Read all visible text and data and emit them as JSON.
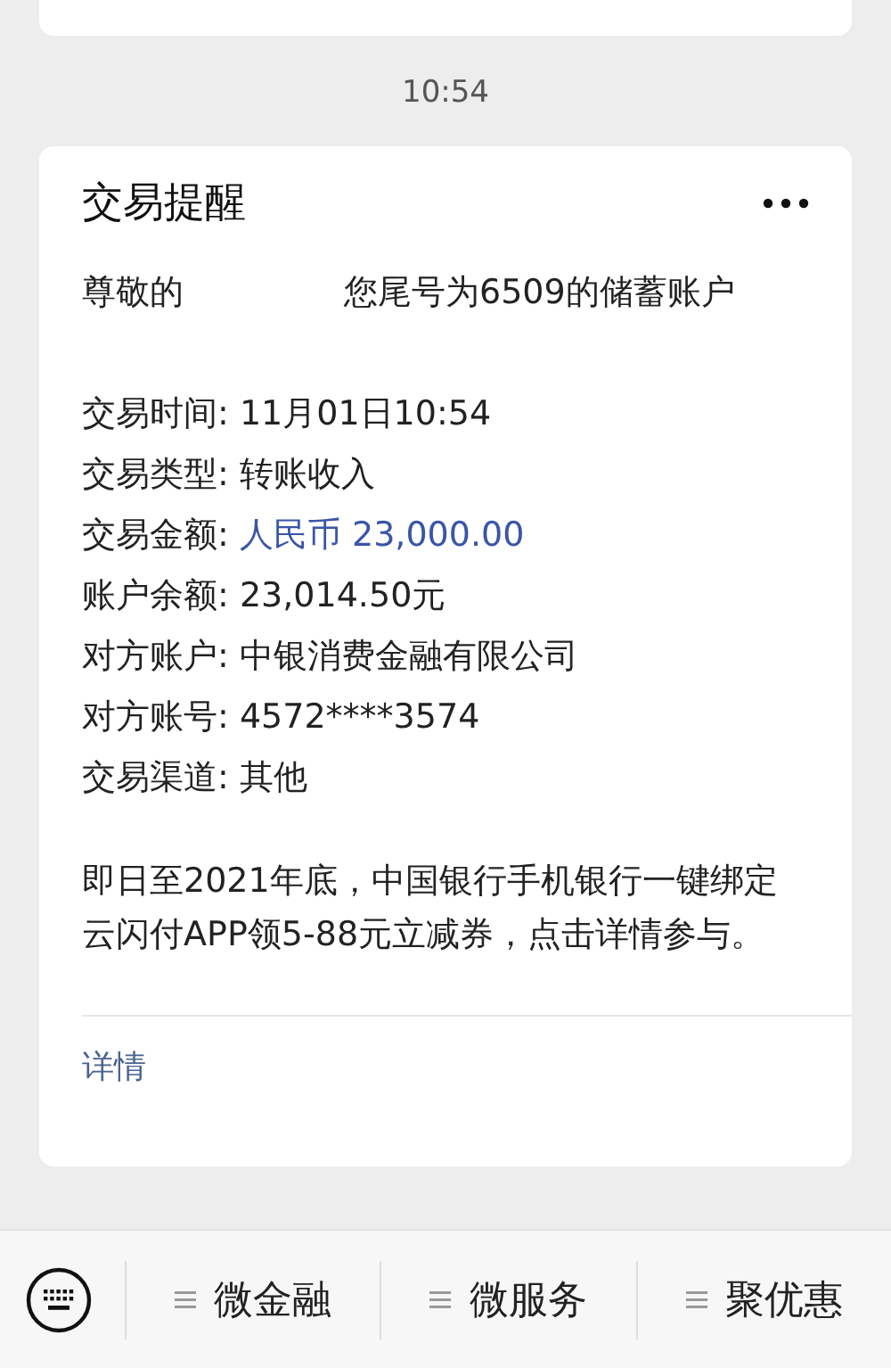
{
  "time": "10:54",
  "card": {
    "title": "交易提醒",
    "greeting": [
      "尊敬的",
      "您尾号为6509的储蓄账户"
    ],
    "fields": [
      {
        "label": "交易时间:",
        "value": "11月01日10:54",
        "highlight": false
      },
      {
        "label": "交易类型:",
        "value": "转账收入",
        "highlight": false
      },
      {
        "label": "交易金额:",
        "value": "人民币 23,000.00",
        "highlight": true
      },
      {
        "label": "账户余额:",
        "value": "23,014.50元",
        "highlight": false
      },
      {
        "label": "对方账户:",
        "value": "中银消费金融有限公司",
        "highlight": false
      },
      {
        "label": "对方账号:",
        "value": "4572****3574",
        "highlight": false
      },
      {
        "label": "交易渠道:",
        "value": "其他",
        "highlight": false
      }
    ],
    "promo": "即日至2021年底，中国银行手机银行一键绑定云闪付APP领5-88元立减券，点击详情参与。",
    "details_link": "详情"
  },
  "menu": [
    "微金融",
    "微服务",
    "聚优惠"
  ]
}
